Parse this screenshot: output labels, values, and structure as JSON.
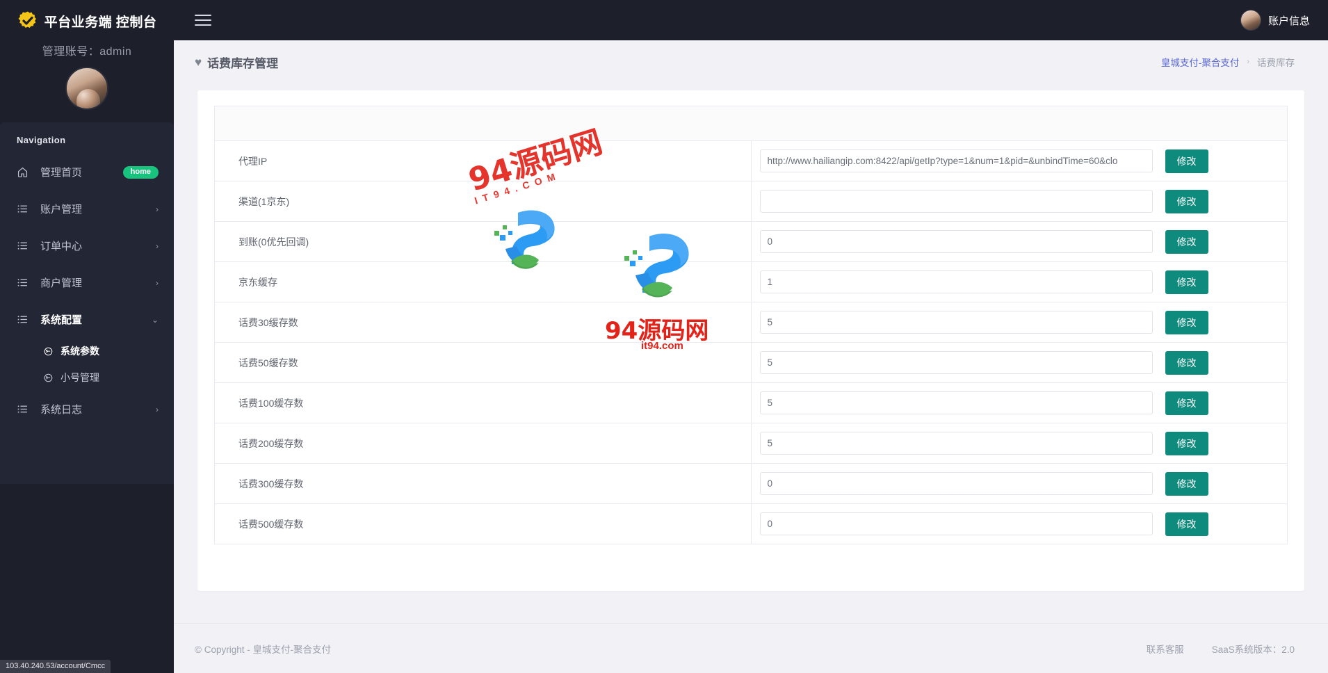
{
  "sidebar": {
    "brand_title": "平台业务端 控制台",
    "brand_icon": "gear-check-icon",
    "account_line": "管理账号：admin",
    "nav_title": "Navigation",
    "items": [
      {
        "label": "管理首页",
        "icon": "home-icon",
        "badge": "home",
        "chevron": ""
      },
      {
        "label": "账户管理",
        "icon": "list-icon",
        "badge": "",
        "chevron": "›"
      },
      {
        "label": "订单中心",
        "icon": "list-icon",
        "badge": "",
        "chevron": "›"
      },
      {
        "label": "商户管理",
        "icon": "list-icon",
        "badge": "",
        "chevron": "›"
      },
      {
        "label": "系统配置",
        "icon": "list-icon",
        "badge": "",
        "chevron": "⌄"
      }
    ],
    "subitems": [
      {
        "label": "系统参数",
        "icon": "node-icon",
        "active": true
      },
      {
        "label": "小号管理",
        "icon": "node-icon",
        "active": false
      }
    ],
    "last_item": {
      "label": "系统日志",
      "icon": "list-icon",
      "badge": "",
      "chevron": "›"
    }
  },
  "statusbar": {
    "url": "103.40.240.53/account/Cmcc"
  },
  "topbar": {
    "menu_icon": "hamburger-icon",
    "account_label": "账户信息",
    "avatar_icon": "user-avatar"
  },
  "page": {
    "title": "话费库存管理",
    "title_icon": "heart-icon",
    "breadcrumb": {
      "root": "皇城支付-聚合支付",
      "separator": "›",
      "current": "话费库存"
    }
  },
  "table": {
    "rows": [
      {
        "label": "代理IP",
        "value": "http://www.hailiangip.com:8422/api/getIp?type=1&num=1&pid=&unbindTime=60&clo",
        "button": "修改"
      },
      {
        "label": "渠道(1京东)",
        "value": "",
        "button": "修改"
      },
      {
        "label": "到账(0优先回调)",
        "value": "0",
        "button": "修改"
      },
      {
        "label": "京东缓存",
        "value": "1",
        "button": "修改"
      },
      {
        "label": "话费30缓存数",
        "value": "5",
        "button": "修改"
      },
      {
        "label": "话费50缓存数",
        "value": "5",
        "button": "修改"
      },
      {
        "label": "话费100缓存数",
        "value": "5",
        "button": "修改"
      },
      {
        "label": "话费200缓存数",
        "value": "5",
        "button": "修改"
      },
      {
        "label": "话费300缓存数",
        "value": "0",
        "button": "修改"
      },
      {
        "label": "话费500缓存数",
        "value": "0",
        "button": "修改"
      }
    ]
  },
  "footer": {
    "copyright": "© Copyright - 皇城支付-聚合支付",
    "support_link": "联系客服",
    "version": "SaaS系统版本：2.0"
  },
  "watermark": {
    "big": "94源码网",
    "sub": "IT94.COM",
    "center": "94源码网",
    "center_sub": "it94.com"
  },
  "colors": {
    "sidebar_bg": "#1d1f2b",
    "nav_bg": "#232634",
    "accent_button": "#0e8b7d",
    "badge_green": "#18c37d",
    "breadcrumb_link": "#5a6ad0",
    "watermark_red": "#e2231a"
  }
}
